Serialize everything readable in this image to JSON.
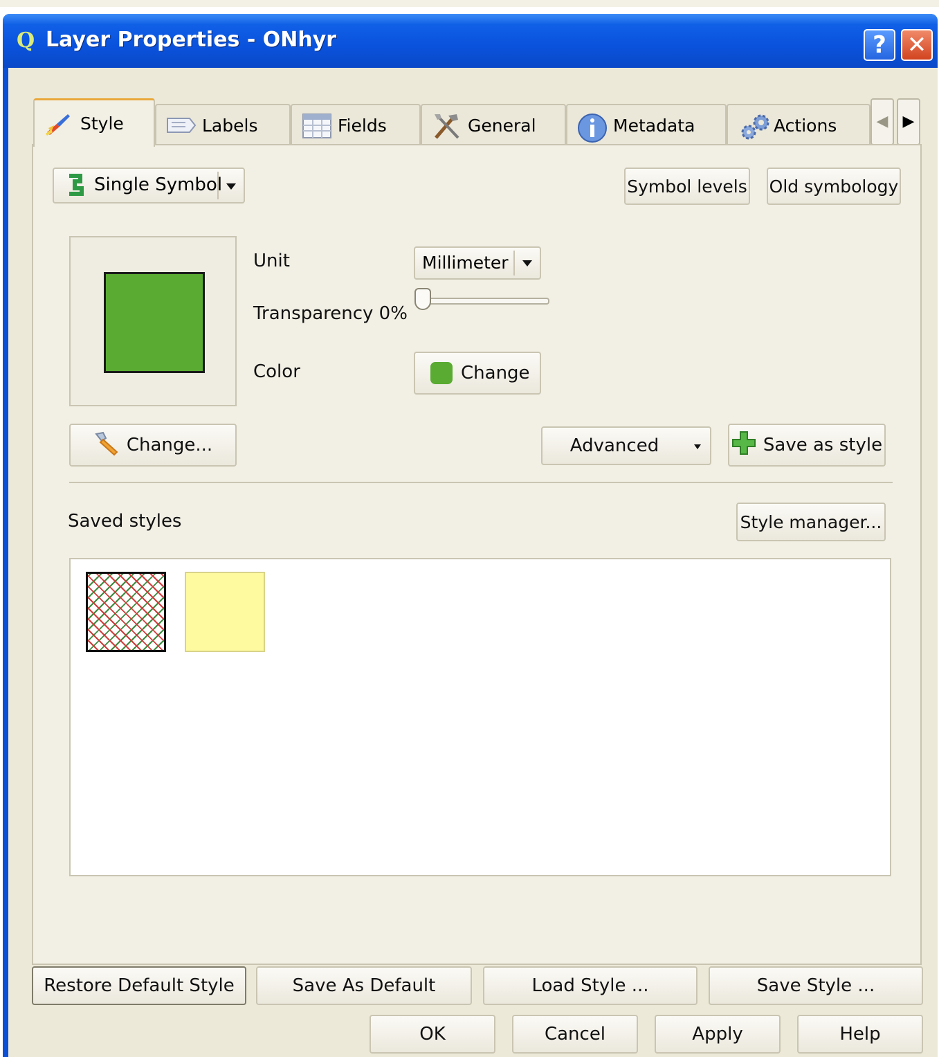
{
  "window": {
    "title": "Layer Properties - ONhyr",
    "help_glyph": "?",
    "close_glyph": "✕"
  },
  "tabs": [
    {
      "label": "Style",
      "icon": "paintbrush-icon",
      "active": true
    },
    {
      "label": "Labels",
      "icon": "label-icon",
      "active": false
    },
    {
      "label": "Fields",
      "icon": "table-icon",
      "active": false
    },
    {
      "label": "General",
      "icon": "tools-icon",
      "active": false
    },
    {
      "label": "Metadata",
      "icon": "info-icon",
      "active": false
    },
    {
      "label": "Actions",
      "icon": "gears-icon",
      "active": false
    }
  ],
  "renderer": {
    "type_value": "Single Symbol",
    "symbol_levels_label": "Symbol levels",
    "old_symbology_label": "Old symbology"
  },
  "symbol": {
    "fill_color": "#5aab32",
    "unit_label": "Unit",
    "unit_value": "Millimeter",
    "transparency_label": "Transparency 0%",
    "transparency_value": 0,
    "color_label": "Color",
    "color_change_label": "Change",
    "change_symbol_label": "Change...",
    "advanced_label": "Advanced",
    "save_as_style_label": "Save as style"
  },
  "saved_styles": {
    "label": "Saved styles",
    "manager_label": "Style manager...",
    "items": [
      {
        "name": "hatch-red-green-icon",
        "colors": [
          "#d23c3c",
          "#3c8a3c"
        ]
      },
      {
        "name": "pale-yellow-icon",
        "colors": [
          "#fefaa0"
        ]
      }
    ]
  },
  "style_buttons": {
    "restore_default": "Restore Default Style",
    "save_as_default": "Save As Default",
    "load_style": "Load Style ...",
    "save_style": "Save Style ..."
  },
  "dialog_buttons": {
    "ok": "OK",
    "cancel": "Cancel",
    "apply": "Apply",
    "help": "Help"
  }
}
